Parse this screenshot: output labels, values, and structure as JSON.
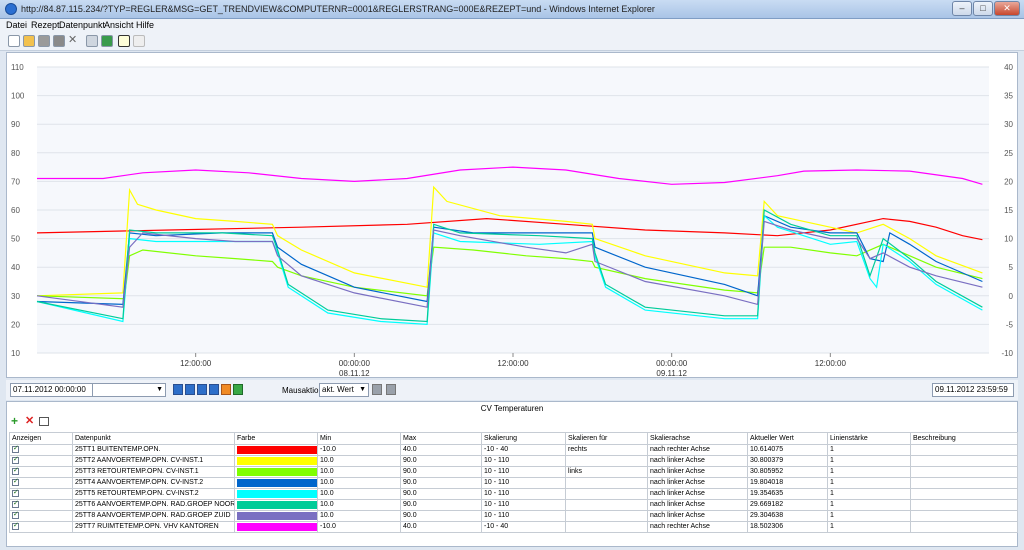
{
  "window": {
    "title": "http://84.87.115.234/?TYP=REGLER&MSG=GET_TRENDVIEW&COMPUTERNR=0001&REGLERSTRANG=000E&REZEPT=und - Windows Internet Explorer"
  },
  "menu": [
    "Datei",
    "Rezept",
    "Datenpunkt",
    "Ansicht",
    "Hilfe"
  ],
  "toolbar_icons": [
    "new-icon",
    "open-icon",
    "save-icon",
    "save-all-icon",
    "delete-icon",
    "print-icon",
    "export-icon",
    "chart-view-icon",
    "comment-icon"
  ],
  "chart_data": {
    "type": "line",
    "left_axis": {
      "ticks": [
        "110",
        "100",
        "90",
        "80",
        "70",
        "60",
        "50",
        "40",
        "30",
        "20",
        "10"
      ],
      "ylim": [
        10,
        110
      ]
    },
    "right_axis": {
      "ticks": [
        "40",
        "35",
        "30",
        "25",
        "20",
        "15",
        "10",
        "5",
        "0",
        "-5",
        "-10"
      ],
      "ylim": [
        -10,
        40
      ]
    },
    "x_ticks": [
      {
        "label": "12:00:00",
        "sub": ""
      },
      {
        "label": "00:00:00",
        "sub": "08.11.12"
      },
      {
        "label": "12:00:00",
        "sub": ""
      },
      {
        "label": "00:00:00",
        "sub": "09.11.12"
      },
      {
        "label": "12:00:00",
        "sub": ""
      }
    ],
    "xlim_hours": [
      0,
      72
    ],
    "x_tick_hours": [
      12,
      24,
      36,
      48,
      60
    ],
    "grid": true,
    "series": [
      {
        "name": "25TT1 BUITENTEMP.OPN.",
        "color": "#ff0000",
        "axis": "right",
        "points": [
          [
            0,
            11.0
          ],
          [
            10,
            11.5
          ],
          [
            20,
            12.0
          ],
          [
            28,
            12.5
          ],
          [
            34,
            13.5
          ],
          [
            40,
            12.5
          ],
          [
            46,
            11.5
          ],
          [
            52,
            11.0
          ],
          [
            56,
            10.5
          ],
          [
            60,
            11.5
          ],
          [
            64,
            13.5
          ],
          [
            66,
            13.0
          ],
          [
            68,
            12.0
          ],
          [
            70,
            10.5
          ],
          [
            71.5,
            9.8
          ]
        ]
      },
      {
        "name": "25TT2 AANVOERTEMP.OPN. CV-INST.1",
        "color": "#ffff00",
        "axis": "left",
        "points": [
          [
            0,
            30
          ],
          [
            6.5,
            31
          ],
          [
            7,
            67
          ],
          [
            7.6,
            62
          ],
          [
            9,
            60
          ],
          [
            12,
            57
          ],
          [
            15,
            56
          ],
          [
            17.8,
            55
          ],
          [
            18.2,
            51
          ],
          [
            20,
            46
          ],
          [
            24,
            38
          ],
          [
            29.5,
            33
          ],
          [
            30,
            68
          ],
          [
            31,
            63
          ],
          [
            35,
            58
          ],
          [
            40,
            56
          ],
          [
            42,
            55
          ],
          [
            42.2,
            50
          ],
          [
            46,
            44
          ],
          [
            52,
            38
          ],
          [
            54.5,
            37
          ],
          [
            55,
            63
          ],
          [
            56,
            58
          ],
          [
            60,
            54
          ],
          [
            62,
            52
          ],
          [
            64,
            55
          ],
          [
            66,
            50
          ],
          [
            68,
            44
          ],
          [
            71.5,
            38
          ]
        ]
      },
      {
        "name": "25TT3 RETOURTEMP.OPN. CV-INST.1",
        "color": "#80ff00",
        "axis": "left",
        "points": [
          [
            0,
            30
          ],
          [
            6.6,
            29
          ],
          [
            7,
            44
          ],
          [
            8,
            46
          ],
          [
            12,
            44
          ],
          [
            15,
            43
          ],
          [
            17.8,
            42
          ],
          [
            18.2,
            40
          ],
          [
            20,
            37
          ],
          [
            24,
            33
          ],
          [
            29.5,
            30
          ],
          [
            30,
            47
          ],
          [
            33,
            46
          ],
          [
            37,
            44
          ],
          [
            40,
            43
          ],
          [
            42,
            42
          ],
          [
            42.2,
            40
          ],
          [
            46,
            36
          ],
          [
            52,
            32
          ],
          [
            54.5,
            31
          ],
          [
            55,
            47
          ],
          [
            57,
            47
          ],
          [
            60,
            45
          ],
          [
            62,
            44
          ],
          [
            64,
            48
          ],
          [
            66,
            44
          ],
          [
            68,
            40
          ],
          [
            71.5,
            36
          ]
        ]
      },
      {
        "name": "25TT4 AANVOERTEMP.OPN. CV-INST.2",
        "color": "#0066cc",
        "axis": "left",
        "points": [
          [
            0,
            28
          ],
          [
            6.5,
            27
          ],
          [
            7,
            52
          ],
          [
            9,
            51
          ],
          [
            14,
            52
          ],
          [
            17.8,
            52
          ],
          [
            18.2,
            47
          ],
          [
            20,
            41
          ],
          [
            24,
            33
          ],
          [
            29.5,
            28
          ],
          [
            30,
            54
          ],
          [
            33,
            52
          ],
          [
            38,
            52
          ],
          [
            42,
            52
          ],
          [
            42.2,
            47
          ],
          [
            46,
            40
          ],
          [
            52,
            34
          ],
          [
            54.5,
            30
          ],
          [
            55,
            58
          ],
          [
            57,
            54
          ],
          [
            60,
            52
          ],
          [
            62,
            52
          ],
          [
            63,
            43
          ],
          [
            64,
            42
          ],
          [
            64.5,
            52
          ],
          [
            66,
            48
          ],
          [
            68,
            42
          ],
          [
            71.5,
            35
          ]
        ]
      },
      {
        "name": "25TT5 RETOURTEMP.OPN. CV-INST.2",
        "color": "#00ffff",
        "axis": "left",
        "points": [
          [
            0,
            28
          ],
          [
            6.5,
            21
          ],
          [
            7,
            50
          ],
          [
            9,
            49
          ],
          [
            14,
            49
          ],
          [
            17.8,
            49
          ],
          [
            18.2,
            45
          ],
          [
            19,
            33
          ],
          [
            22,
            24
          ],
          [
            26,
            21
          ],
          [
            29.5,
            20
          ],
          [
            30,
            52
          ],
          [
            32,
            49
          ],
          [
            38,
            48
          ],
          [
            42,
            49
          ],
          [
            42.2,
            44
          ],
          [
            43,
            33
          ],
          [
            46,
            25
          ],
          [
            52,
            22
          ],
          [
            54.5,
            22
          ],
          [
            55,
            58
          ],
          [
            56,
            54
          ],
          [
            60,
            48
          ],
          [
            62,
            49
          ],
          [
            63,
            36
          ],
          [
            63.5,
            33
          ],
          [
            64,
            48
          ],
          [
            66,
            42
          ],
          [
            68,
            34
          ],
          [
            71.5,
            25
          ]
        ]
      },
      {
        "name": "25TT6 AANVOERTEMP.OPN. RAD.GROEP NOORD",
        "color": "#00cc99",
        "axis": "left",
        "points": [
          [
            0,
            28
          ],
          [
            6.5,
            22
          ],
          [
            7,
            53
          ],
          [
            9,
            52
          ],
          [
            14,
            52
          ],
          [
            17.8,
            51
          ],
          [
            18.2,
            46
          ],
          [
            19,
            34
          ],
          [
            22,
            25
          ],
          [
            26,
            22
          ],
          [
            29.5,
            21
          ],
          [
            30,
            55
          ],
          [
            32,
            52
          ],
          [
            38,
            51
          ],
          [
            42,
            50
          ],
          [
            42.2,
            45
          ],
          [
            43,
            34
          ],
          [
            46,
            26
          ],
          [
            52,
            23
          ],
          [
            54.5,
            23
          ],
          [
            55,
            60
          ],
          [
            57,
            55
          ],
          [
            60,
            51
          ],
          [
            62,
            51
          ],
          [
            63,
            37
          ],
          [
            64,
            50
          ],
          [
            66,
            43
          ],
          [
            68,
            35
          ],
          [
            71.5,
            26
          ]
        ]
      },
      {
        "name": "25TT8 AANVOERTEMP.OPN. RAD.GROEP ZUID",
        "color": "#7a6fc2",
        "axis": "left",
        "points": [
          [
            0,
            30
          ],
          [
            6.5,
            26
          ],
          [
            7,
            47
          ],
          [
            8,
            52
          ],
          [
            12,
            50
          ],
          [
            15,
            49
          ],
          [
            17.8,
            49
          ],
          [
            18.2,
            44
          ],
          [
            20,
            37
          ],
          [
            24,
            31
          ],
          [
            29.5,
            26
          ],
          [
            30,
            53
          ],
          [
            32,
            51
          ],
          [
            37,
            47
          ],
          [
            40,
            45
          ],
          [
            42,
            48
          ],
          [
            42.2,
            42
          ],
          [
            46,
            35
          ],
          [
            52,
            30
          ],
          [
            54.5,
            27
          ],
          [
            55,
            56
          ],
          [
            57,
            53
          ],
          [
            60,
            50
          ],
          [
            62,
            50
          ],
          [
            63,
            43
          ],
          [
            64,
            45
          ],
          [
            66,
            40
          ],
          [
            68,
            37
          ],
          [
            71.5,
            33
          ]
        ]
      },
      {
        "name": "29TT7 RUIMTETEMP.OPN. VHV KANTOREN",
        "color": "#ff00ff",
        "axis": "right",
        "points": [
          [
            0,
            20.5
          ],
          [
            5,
            20.5
          ],
          [
            8,
            21.5
          ],
          [
            12,
            22.0
          ],
          [
            16,
            21.5
          ],
          [
            20,
            20.5
          ],
          [
            24,
            20.0
          ],
          [
            28,
            20.5
          ],
          [
            32,
            22.0
          ],
          [
            36,
            22.5
          ],
          [
            40,
            22.0
          ],
          [
            44,
            20.5
          ],
          [
            48,
            19.5
          ],
          [
            52,
            19.8
          ],
          [
            56,
            21.0
          ],
          [
            58,
            21.8
          ],
          [
            62,
            22.0
          ],
          [
            66,
            21.8
          ],
          [
            70,
            20.5
          ],
          [
            71.5,
            19.5
          ]
        ]
      }
    ]
  },
  "controls": {
    "start_date": "07.11.2012 00:00:00",
    "end_date": "09.11.2012 23:59:59",
    "dropdown": "",
    "mouse_label": "Mausaktion:",
    "mouse_value": "akt. Wert"
  },
  "panel": {
    "title": "CV Temperaturen",
    "headers": [
      "Anzeigen",
      "Datenpunkt",
      "Farbe",
      "Min",
      "Max",
      "Skalierung",
      "Skalieren für",
      "Skalierachse",
      "Aktueller Wert",
      "Linienstärke",
      "Beschreibung"
    ],
    "rows": [
      {
        "name": "25TT1 BUITENTEMP.OPN.",
        "color": "#ff0000",
        "min": "-10.0",
        "max": "40.0",
        "scale": "-10 - 40",
        "scale_for": "rechts",
        "axis": "nach rechter Achse",
        "value": "10.614075",
        "width": "1",
        "desc": ""
      },
      {
        "name": "25TT2 AANVOERTEMP.OPN. CV-INST.1",
        "color": "#ffff00",
        "min": "10.0",
        "max": "90.0",
        "scale": "10 - 110",
        "scale_for": "",
        "axis": "nach linker Achse",
        "value": "30.800379",
        "width": "1",
        "desc": ""
      },
      {
        "name": "25TT3 RETOURTEMP.OPN. CV-INST.1",
        "color": "#80ff00",
        "min": "10.0",
        "max": "90.0",
        "scale": "10 - 110",
        "scale_for": "links",
        "axis": "nach linker Achse",
        "value": "30.805952",
        "width": "1",
        "desc": ""
      },
      {
        "name": "25TT4 AANVOERTEMP.OPN. CV-INST.2",
        "color": "#0066cc",
        "min": "10.0",
        "max": "90.0",
        "scale": "10 - 110",
        "scale_for": "",
        "axis": "nach linker Achse",
        "value": "19.804018",
        "width": "1",
        "desc": ""
      },
      {
        "name": "25TT5 RETOURTEMP.OPN. CV-INST.2",
        "color": "#00ffff",
        "min": "10.0",
        "max": "90.0",
        "scale": "10 - 110",
        "scale_for": "",
        "axis": "nach linker Achse",
        "value": "19.354635",
        "width": "1",
        "desc": ""
      },
      {
        "name": "25TT6 AANVOERTEMP.OPN. RAD.GROEP NOORD",
        "color": "#00cc99",
        "min": "10.0",
        "max": "90.0",
        "scale": "10 - 110",
        "scale_for": "",
        "axis": "nach linker Achse",
        "value": "29.669182",
        "width": "1",
        "desc": ""
      },
      {
        "name": "25TT8 AANVOERTEMP.OPN. RAD.GROEP ZUID",
        "color": "#7a6fc2",
        "min": "10.0",
        "max": "90.0",
        "scale": "10 - 110",
        "scale_for": "",
        "axis": "nach linker Achse",
        "value": "29.304638",
        "width": "1",
        "desc": ""
      },
      {
        "name": "29TT7 RUIMTETEMP.OPN. VHV KANTOREN",
        "color": "#ff00ff",
        "min": "-10.0",
        "max": "40.0",
        "scale": "-10 - 40",
        "scale_for": "",
        "axis": "nach rechter Achse",
        "value": "18.502306",
        "width": "1",
        "desc": ""
      }
    ]
  }
}
